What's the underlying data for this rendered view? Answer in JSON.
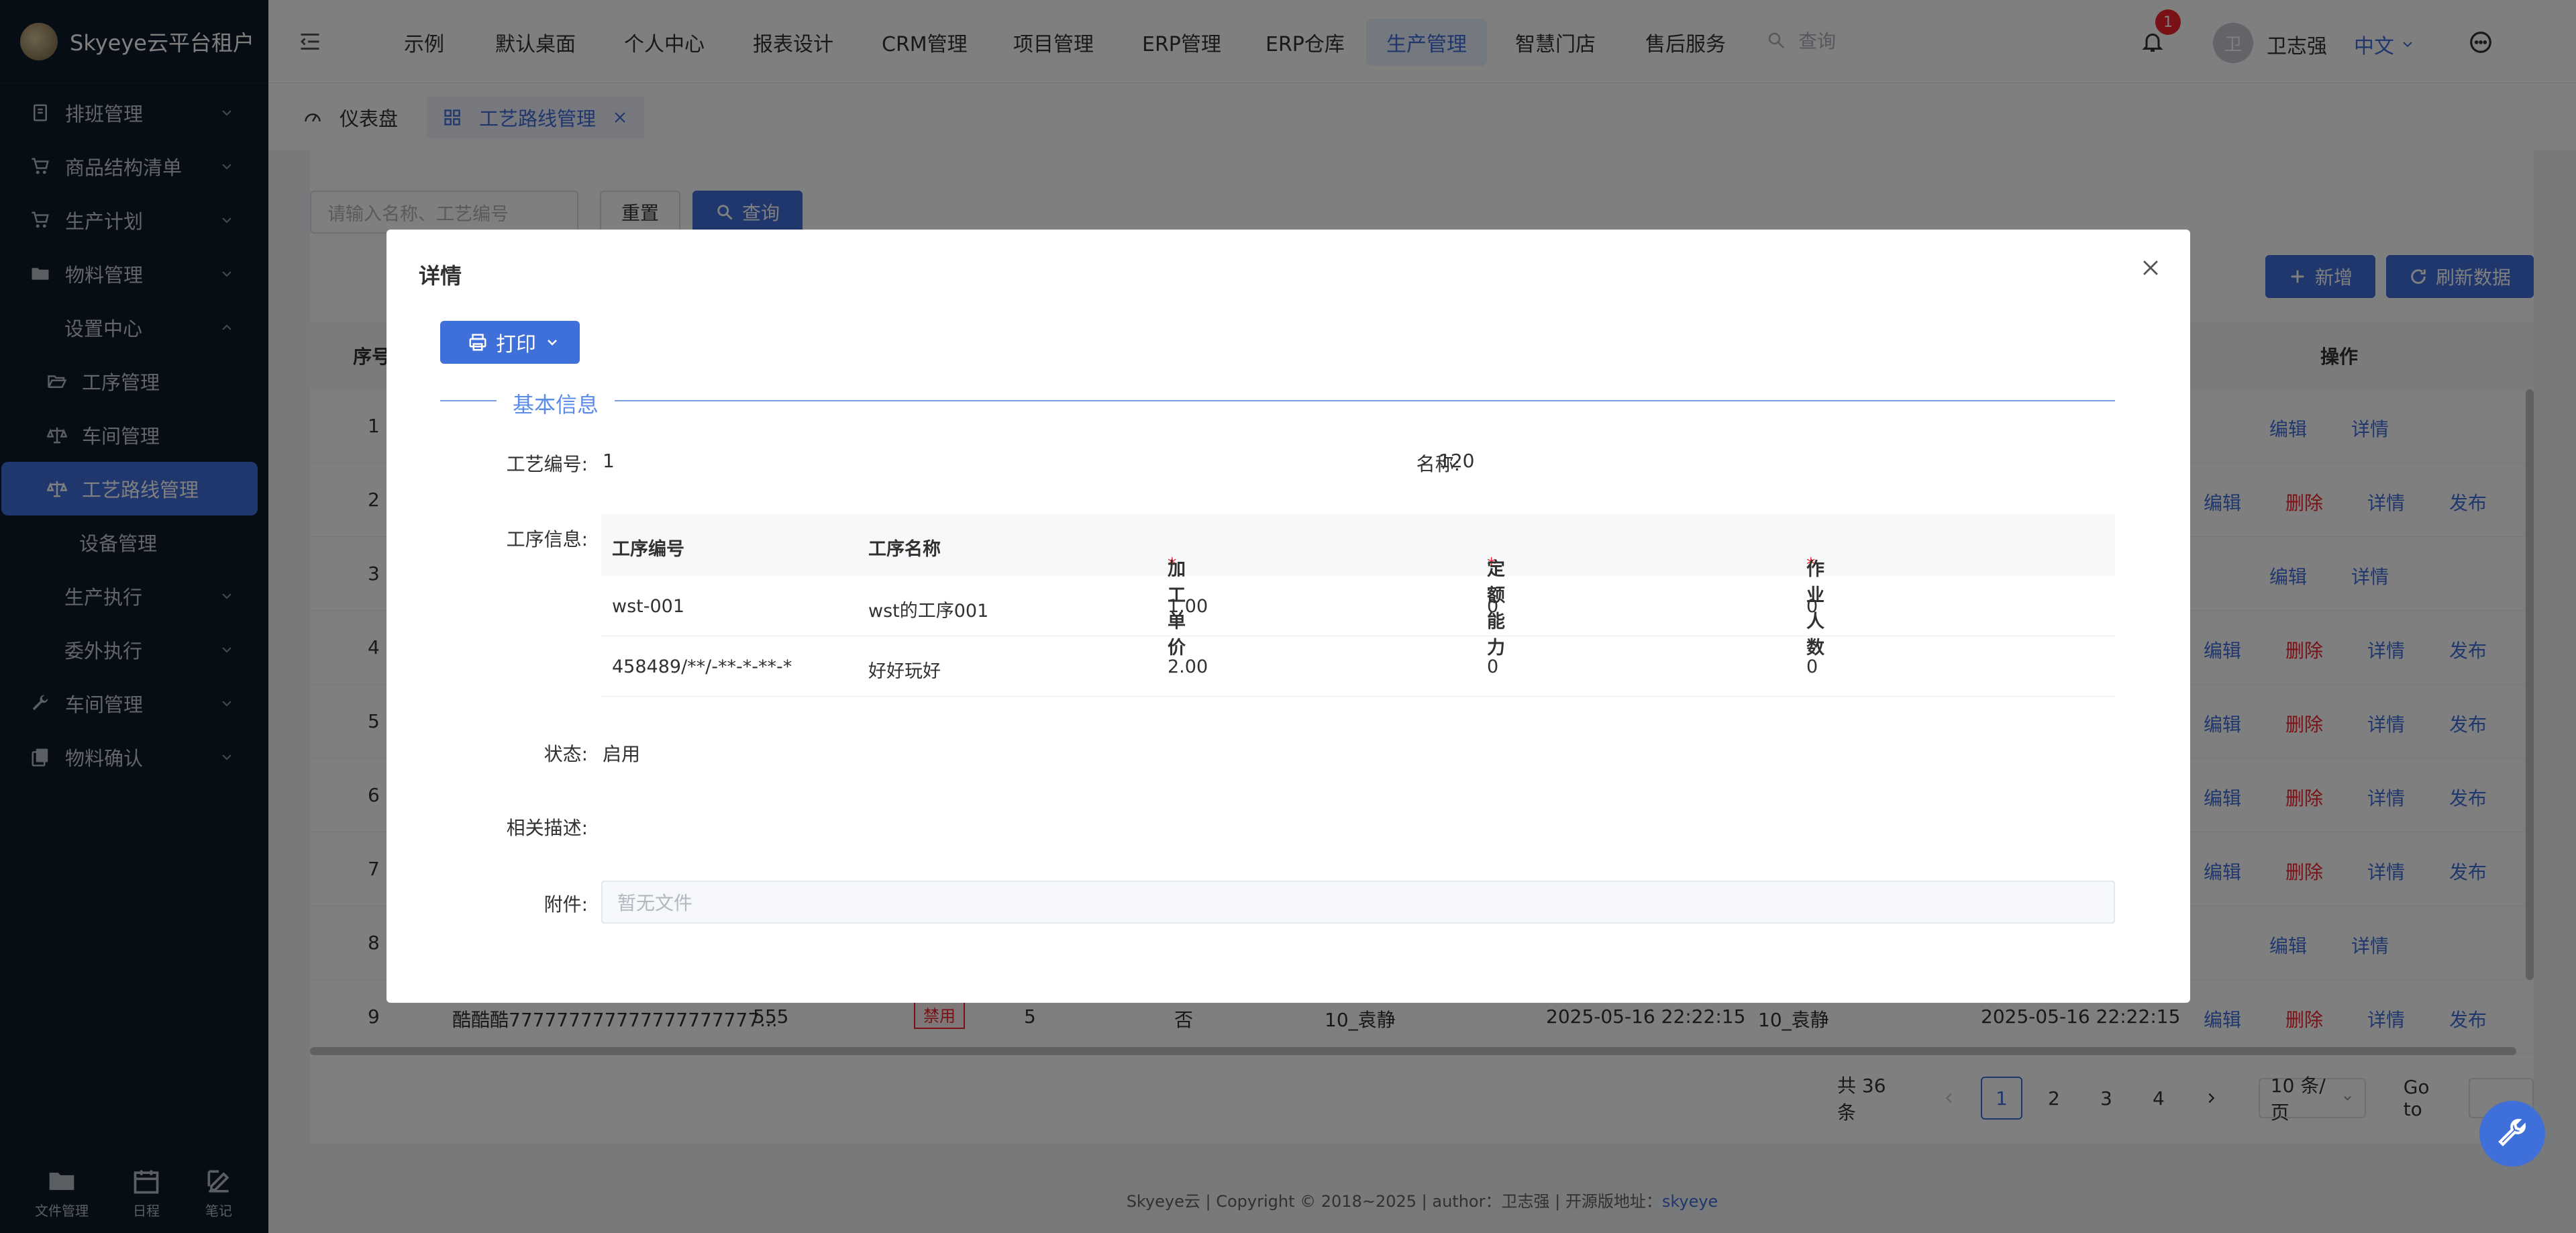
{
  "brand": {
    "name": "Skyeye云平台租户"
  },
  "sidebar": {
    "items": [
      {
        "label": "排班管理",
        "icon": "clipboard-icon"
      },
      {
        "label": "商品结构清单",
        "icon": "cart-icon"
      },
      {
        "label": "生产计划",
        "icon": "cart-icon"
      },
      {
        "label": "物料管理",
        "icon": "folder-icon"
      },
      {
        "label": "设置中心",
        "icon": ""
      },
      {
        "label": "工序管理",
        "icon": "folder-open-icon"
      },
      {
        "label": "车间管理",
        "icon": "scale-icon"
      },
      {
        "label": "工艺路线管理",
        "icon": "scale-icon"
      },
      {
        "label": "设备管理",
        "icon": ""
      },
      {
        "label": "生产执行",
        "icon": ""
      },
      {
        "label": "委外执行",
        "icon": ""
      },
      {
        "label": "车间管理",
        "icon": "wrench-icon"
      },
      {
        "label": "物料确认",
        "icon": "copy-icon"
      }
    ],
    "tools": [
      {
        "label": "文件管理",
        "icon": "folder-icon"
      },
      {
        "label": "日程",
        "icon": "calendar-icon"
      },
      {
        "label": "笔记",
        "icon": "edit-icon"
      }
    ]
  },
  "nav": {
    "items": [
      "示例",
      "默认桌面",
      "个人中心",
      "报表设计",
      "CRM管理",
      "项目管理",
      "ERP管理",
      "ERP仓库",
      "生产管理",
      "智慧门店",
      "售后服务"
    ],
    "active": "生产管理",
    "search_placeholder": "查询",
    "notification_count": "1",
    "avatar_initial": "卫",
    "username": "卫志强",
    "language": "中文"
  },
  "tabs": [
    {
      "label": "仪表盘"
    },
    {
      "label": "工艺路线管理"
    }
  ],
  "list": {
    "search_placeholder": "请输入名称、工艺编号",
    "reset_label": "重置",
    "query_label": "查询",
    "add_label": "新增",
    "refresh_label": "刷新数据",
    "col_index": "序号",
    "col_ops": "操作",
    "row_numbers": [
      "1",
      "2",
      "3",
      "4",
      "5",
      "6",
      "7",
      "8"
    ],
    "op_edit": "编辑",
    "op_delete": "删除",
    "op_detail": "详情",
    "op_publish": "发布",
    "last_row": {
      "num": "9",
      "name": "酷酷酷777777777777777777777...",
      "code": "555",
      "status": "禁用",
      "count": "5",
      "flag": "否",
      "creator": "10_袁静",
      "created": "2025-05-16 22:22:15",
      "updater": "10_袁静",
      "updated": "2025-05-16 22:22:15"
    },
    "total": "共 36 条",
    "pages": [
      "1",
      "2",
      "3",
      "4"
    ],
    "current_page": "1",
    "page_size": "10 条/页",
    "goto_label": "Go to"
  },
  "footer": {
    "text": "Skyeye云 | Copyright © 2018~2025 | author：卫志强 | 开源版地址：",
    "link": "skyeye"
  },
  "dialog": {
    "title": "详情",
    "print_label": "打印",
    "section_title": "基本信息",
    "code_label": "工艺编号:",
    "code_value": "1",
    "name_label": "名称:",
    "name_value": "120",
    "proc_label": "工序信息:",
    "proc_columns": [
      "工序编号",
      "工序名称",
      "加工单价",
      "定额能力",
      "作业人数"
    ],
    "proc_rows": [
      [
        "wst-001",
        "wst的工序001",
        "1.00",
        "0",
        "0"
      ],
      [
        "458489/**/-**-*-**-*",
        "好好玩好",
        "2.00",
        "0",
        "0"
      ]
    ],
    "status_label": "状态:",
    "status_value": "启用",
    "desc_label": "相关描述:",
    "desc_value": "",
    "attach_label": "附件:",
    "attach_placeholder": "暂无文件"
  },
  "colors": {
    "accent": "#3f6fd9",
    "danger": "#f5222d",
    "sidebar_bg": "#0f1a2b"
  }
}
